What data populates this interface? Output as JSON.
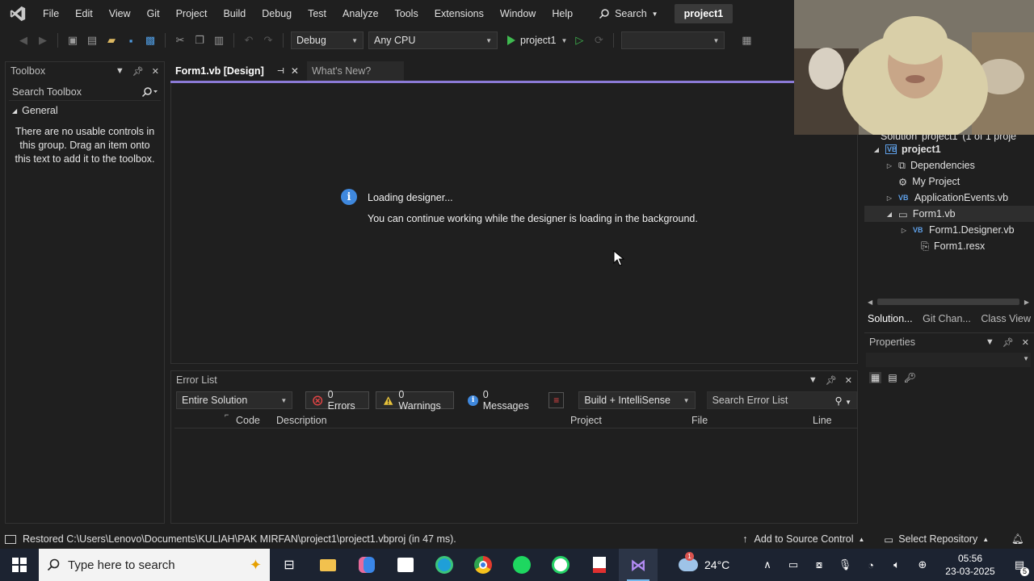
{
  "menubar": {
    "items": [
      "File",
      "Edit",
      "View",
      "Git",
      "Project",
      "Build",
      "Debug",
      "Test",
      "Analyze",
      "Tools",
      "Extensions",
      "Window",
      "Help"
    ],
    "search_label": "Search",
    "project_name": "project1"
  },
  "toolbar": {
    "config": "Debug",
    "platform": "Any CPU",
    "run_target": "project1"
  },
  "toolbox": {
    "title": "Toolbox",
    "search_placeholder": "Search Toolbox",
    "group": "General",
    "empty_message": "There are no usable controls in this group. Drag an item onto this text to add it to the toolbox."
  },
  "tabs": [
    {
      "label": "Form1.vb [Design]",
      "active": true
    },
    {
      "label": "What's New?",
      "active": false
    }
  ],
  "designer": {
    "loading_title": "Loading designer...",
    "loading_message": "You can continue working while the designer is loading in the background."
  },
  "error_list": {
    "title": "Error List",
    "scope": "Entire Solution",
    "errors": "0 Errors",
    "warnings": "0 Warnings",
    "messages": "0 Messages",
    "source": "Build + IntelliSense",
    "search_placeholder": "Search Error List",
    "columns": [
      "Code",
      "Description",
      "Project",
      "File",
      "Line"
    ]
  },
  "solution_explorer": {
    "header_partial": "Solution 'project1' (1 of 1 proje",
    "items": [
      {
        "label": "project1",
        "icon": "vb-project-icon",
        "bold": true
      },
      {
        "label": "Dependencies",
        "icon": "dependencies-icon"
      },
      {
        "label": "My Project",
        "icon": "my-project-icon"
      },
      {
        "label": "ApplicationEvents.vb",
        "icon": "vb-file-icon"
      },
      {
        "label": "Form1.vb",
        "icon": "form-icon"
      },
      {
        "label": "Form1.Designer.vb",
        "icon": "vb-file-icon"
      },
      {
        "label": "Form1.resx",
        "icon": "resx-icon"
      }
    ],
    "bottom_tabs": [
      "Solution...",
      "Git Chan...",
      "Class View"
    ]
  },
  "properties": {
    "title": "Properties"
  },
  "statusbar": {
    "message": "Restored C:\\Users\\Lenovo\\Documents\\KULIAH\\PAK MIRFAN\\project1\\project1.vbproj (in 47 ms).",
    "source_control": "Add to Source Control",
    "repository": "Select Repository"
  },
  "taskbar": {
    "search_placeholder": "Type here to search",
    "temperature": "24°C",
    "time": "05:56",
    "date": "23-03-2025",
    "notification_count": "5",
    "weather_badge": "1"
  },
  "colors": {
    "accent": "#8b7ad6",
    "info_blue": "#3f88dd",
    "run_green": "#3fba50",
    "error_red": "#e04545",
    "warning_yellow": "#e8c33b",
    "taskbar_bg": "#1c2331"
  }
}
